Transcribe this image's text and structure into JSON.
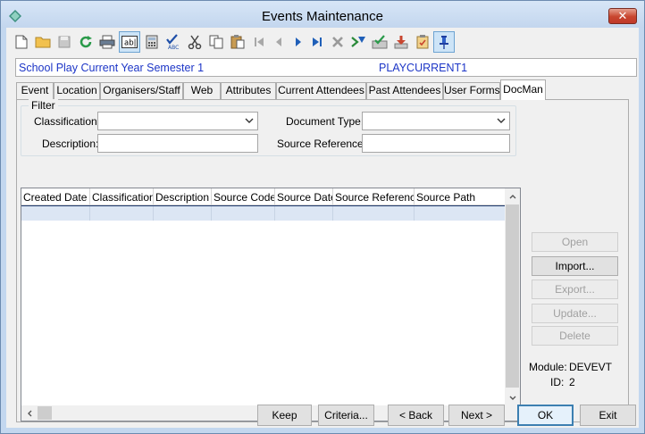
{
  "window": {
    "title": "Events Maintenance",
    "close_label": "✕"
  },
  "toolbar": {
    "icons": [
      "new-icon",
      "open-folder-icon",
      "save-icon",
      "refresh-icon",
      "print-icon",
      "text-field-icon",
      "calculator-icon",
      "spellcheck-icon",
      "cut-icon",
      "copy-icon",
      "paste-icon",
      "first-record-icon",
      "previous-record-icon",
      "next-record-icon",
      "last-record-icon",
      "delete-icon",
      "filter-icon",
      "approve-icon",
      "download-icon",
      "clipboard-icon",
      "pin-icon"
    ]
  },
  "record": {
    "name": "School Play Current Year Semester 1",
    "code": "PLAYCURRENT1"
  },
  "tabs": [
    "Event",
    "Location",
    "Organisers/Staff",
    "Web",
    "Attributes",
    "Current Attendees",
    "Past Attendees",
    "User Forms",
    "DocMan"
  ],
  "filter": {
    "legend": "Filter",
    "classification_label": "Classification:",
    "classification_value": "",
    "document_type_label": "Document Type:",
    "document_type_value": "",
    "description_label": "Description:",
    "description_value": "",
    "source_reference_label": "Source Reference:",
    "source_reference_value": ""
  },
  "grid": {
    "columns": [
      "Created Date",
      "Classification",
      "Description",
      "Source Code",
      "Source Date",
      "Source Reference",
      "Source Path"
    ],
    "rows": [
      [
        "",
        "",
        "",
        "",
        "",
        "",
        ""
      ]
    ]
  },
  "side_buttons": {
    "open": "Open",
    "import": "Import...",
    "export": "Export...",
    "update": "Update...",
    "delete": "Delete"
  },
  "info": {
    "module_label": "Module:",
    "module_value": "DEVEVT",
    "id_label": "ID:",
    "id_value": "2"
  },
  "bottom_buttons": {
    "keep": "Keep",
    "criteria": "Criteria...",
    "back": "< Back",
    "next": "Next >",
    "ok": "OK",
    "exit": "Exit"
  },
  "colors": {
    "record_text": "#1d36c7",
    "selected_row": "#dce6f4",
    "title_bar": "#c3d6ee",
    "close_button": "#c8452e"
  }
}
